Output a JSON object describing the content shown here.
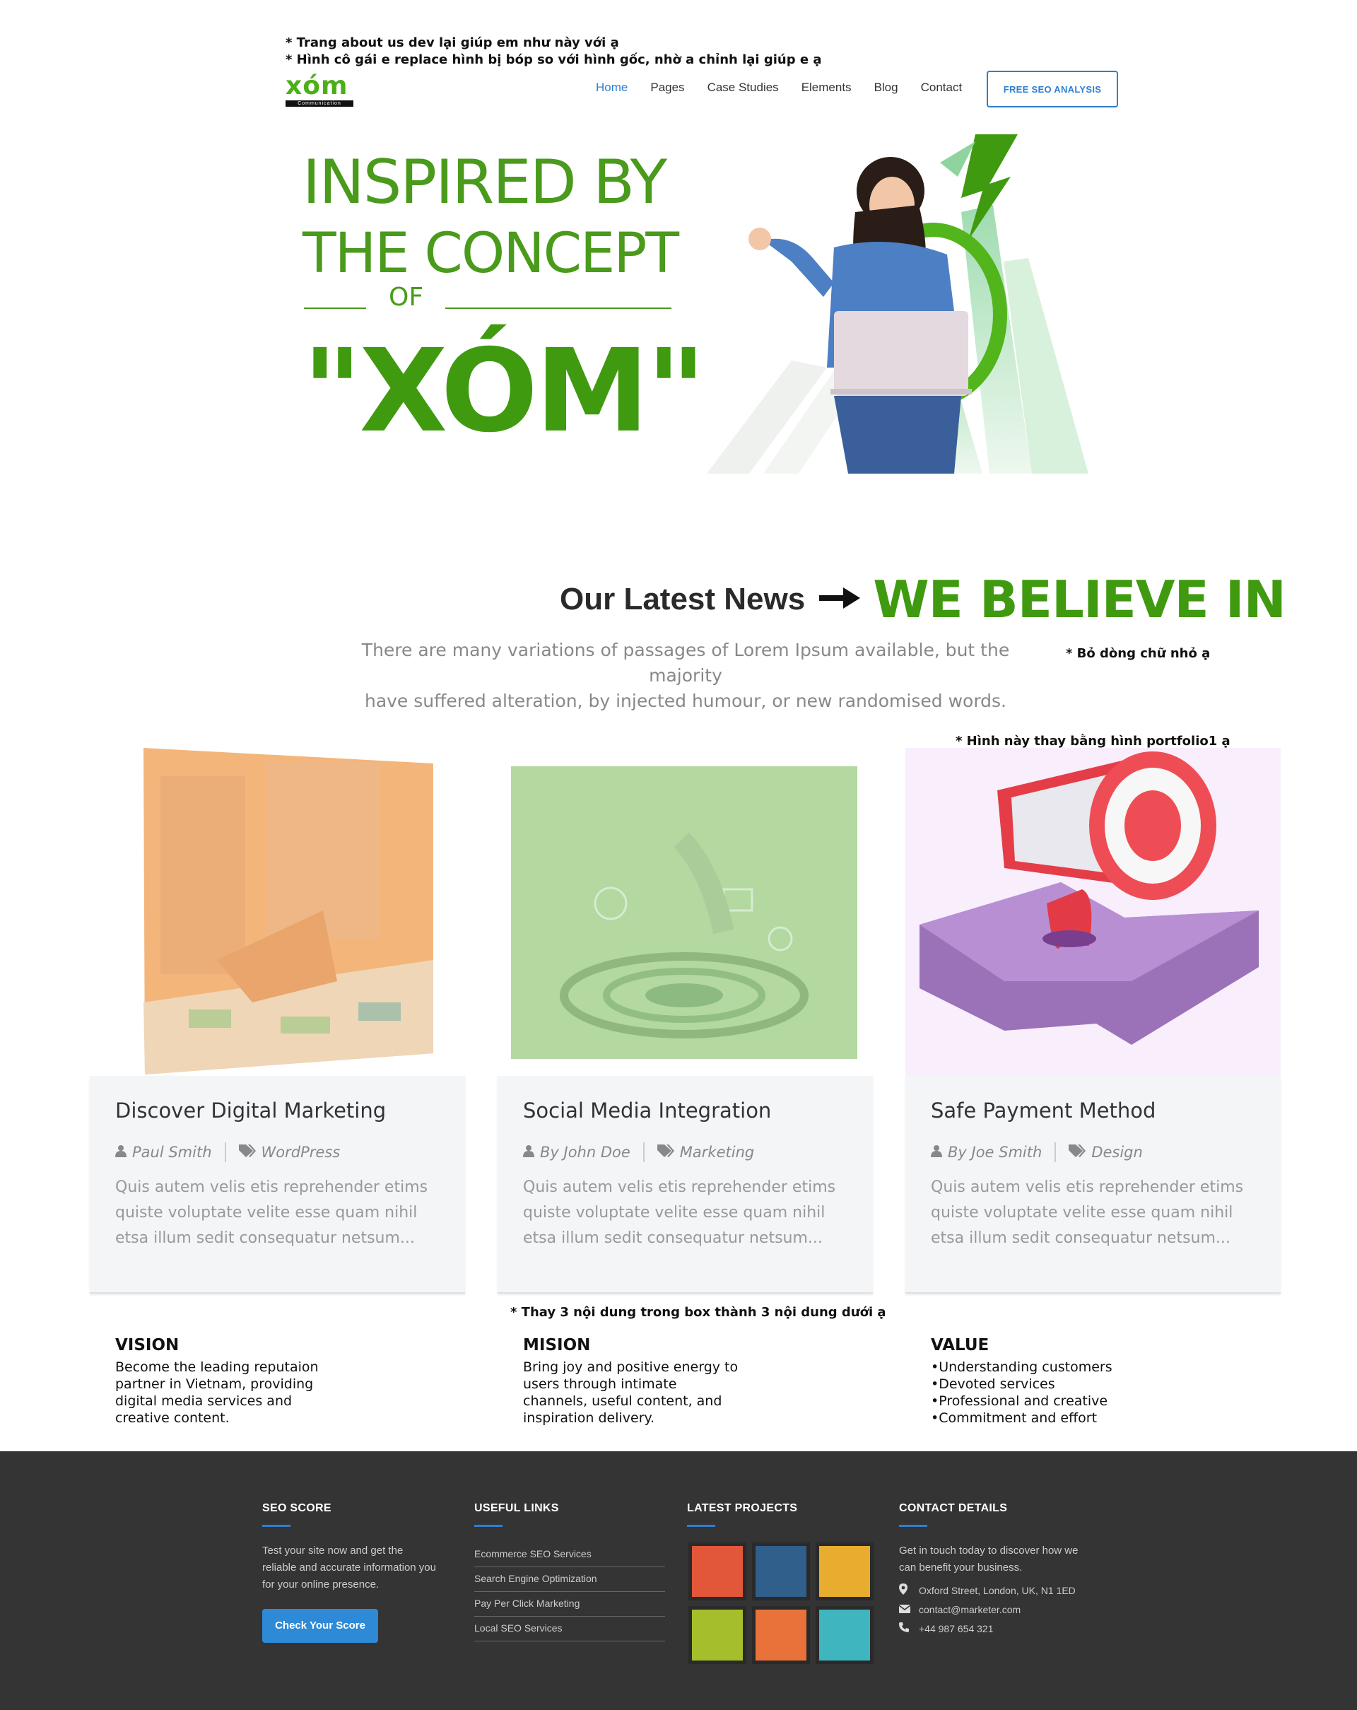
{
  "notes": {
    "top_line1": "* Trang about us dev lại giúp em như này với ạ",
    "top_line2": "* Hình cô gái e replace hình bị bóp so với hình gốc, nhờ a chỉnh lại giúp e ạ",
    "subtitle_note": "* Bỏ dòng chữ nhỏ ạ",
    "portfolio_note": "* Hình này thay bằng hình portfolio1 ạ",
    "box_note": "* Thay 3 nội dung trong box thành 3 nội dung dưới ạ"
  },
  "header": {
    "logo_text": "xóm",
    "logo_sub": "Communication",
    "nav": [
      "Home",
      "Pages",
      "Case Studies",
      "Elements",
      "Blog",
      "Contact"
    ],
    "active_nav": "Home",
    "cta_label": "FREE SEO ANALYSIS"
  },
  "hero": {
    "line1": "INSPIRED BY",
    "line2": "THE CONCEPT",
    "line3": "OF",
    "line4": "\"XÓM\""
  },
  "section": {
    "old_title": "Our Latest News",
    "new_title": "WE BELIEVE IN",
    "subtitle_line1": "There are many variations of passages of Lorem Ipsum available, but the majority",
    "subtitle_line2": "have suffered alteration, by injected humour, or new randomised words."
  },
  "cards": [
    {
      "title": "Discover Digital Marketing",
      "author": "Paul Smith",
      "category": "WordPress",
      "excerpt": "Quis autem velis etis reprehender etims quiste voluptate velite esse quam nihil etsa illum sedit consequatur netsum..."
    },
    {
      "title": "Social Media Integration",
      "author": "By John Doe",
      "category": "Marketing",
      "excerpt": "Quis autem velis etis reprehender etims quiste voluptate velite esse quam nihil etsa illum sedit consequatur netsum..."
    },
    {
      "title": "Safe Payment Method",
      "author": "By Joe Smith",
      "category": "Design",
      "excerpt": "Quis autem velis etis reprehender etims quiste voluptate velite esse quam nihil etsa illum sedit consequatur netsum..."
    }
  ],
  "vmv": {
    "vision": {
      "title": "VISION",
      "text": "Become the leading reputaion partner in Vietnam, providing digital media services and creative content."
    },
    "mission": {
      "title": "MISION",
      "text": "Bring joy and positive energy to users through intimate channels, useful content, and inspiration delivery."
    },
    "value": {
      "title": "VALUE",
      "items": [
        "Understanding customers",
        "Devoted services",
        "Professional and creative",
        "Commitment and effort"
      ]
    }
  },
  "footer": {
    "seo": {
      "title": "SEO SCORE",
      "text": "Test your site now and get the reliable and accurate information you for your online presence.",
      "button": "Check Your Score"
    },
    "links": {
      "title": "USEFUL LINKS",
      "items": [
        "Ecommerce SEO Services",
        "Search Engine Optimization",
        "Pay Per Click Marketing",
        "Local SEO Services"
      ]
    },
    "projects": {
      "title": "LATEST PROJECTS",
      "colors": [
        "#e2573a",
        "#2f5f8a",
        "#e8ac2e",
        "#a4bf2b",
        "#e8723a",
        "#3fb5bf"
      ]
    },
    "contact": {
      "title": "CONTACT DETAILS",
      "text": "Get in touch today to discover how we can benefit your business.",
      "address": "Oxford Street, London, UK, N1 1ED",
      "email": "contact@marketer.com",
      "phone": "+44 987 654 321"
    }
  }
}
